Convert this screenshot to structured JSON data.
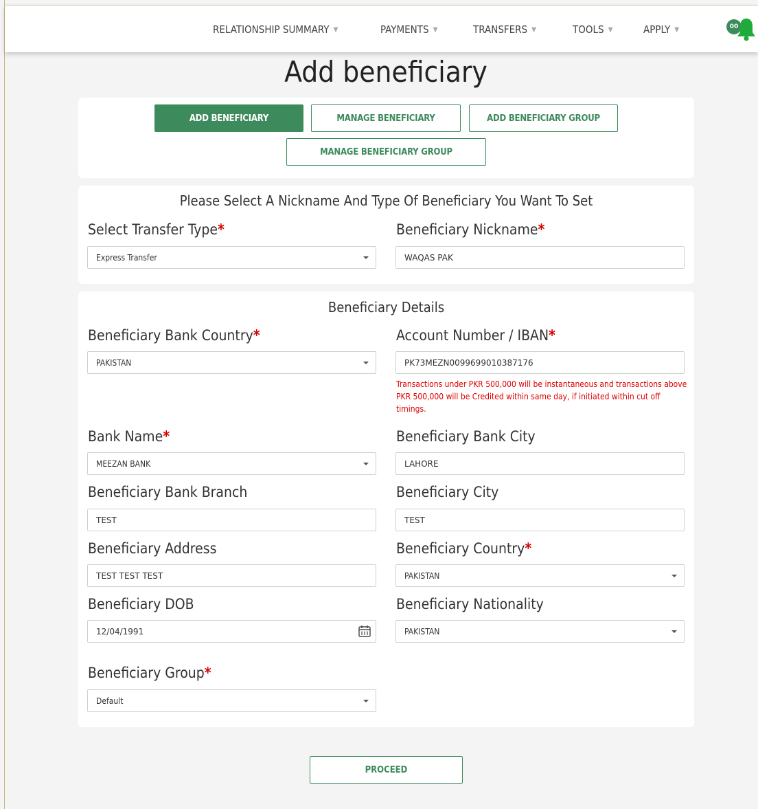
{
  "nav": {
    "items": [
      {
        "label": "RELATIONSHIP SUMMARY"
      },
      {
        "label": "PAYMENTS"
      },
      {
        "label": "TRANSFERS"
      },
      {
        "label": "TOOLS"
      },
      {
        "label": "APPLY"
      }
    ],
    "notification_badge": "00",
    "bell_icon": "bell-icon",
    "caret_icon": "caret-down-icon"
  },
  "page": {
    "title": "Add beneficiary"
  },
  "tabs": [
    {
      "label": "ADD BENEFICIARY",
      "active": true
    },
    {
      "label": "MANAGE BENEFICIARY",
      "active": false
    },
    {
      "label": "ADD BENEFICIARY GROUP",
      "active": false
    },
    {
      "label": "MANAGE BENEFICIARY GROUP",
      "active": false
    }
  ],
  "nickname_section": {
    "title": "Please Select A Nickname And Type Of Beneficiary You Want To Set",
    "transfer_type_label": "Select Transfer Type",
    "transfer_type_value": "Express Transfer",
    "nickname_label": "Beneficiary Nickname",
    "nickname_value": "WAQAS PAK"
  },
  "details_section": {
    "title": "Beneficiary Details",
    "bank_country_label": "Beneficiary Bank Country",
    "bank_country_value": "PAKISTAN",
    "account_label": "Account Number / IBAN",
    "account_value": "PK73MEZN0099699010387176",
    "note": "Transactions under PKR 500,000 will be instantaneous and transactions above PKR 500,000 will be Credited within same day, if initiated within cut off timings.",
    "bank_name_label": "Bank Name",
    "bank_name_value": "MEEZAN BANK",
    "bank_city_label": "Beneficiary Bank City",
    "bank_city_value": "LAHORE",
    "branch_label": "Beneficiary Bank Branch",
    "branch_value": "TEST",
    "city_label": "Beneficiary City",
    "city_value": "TEST",
    "address_label": "Beneficiary Address",
    "address_value": "TEST TEST TEST",
    "country_label": "Beneficiary Country",
    "country_value": "PAKISTAN",
    "dob_label": "Beneficiary DOB",
    "dob_value": "12/04/1991",
    "nationality_label": "Beneficiary Nationality",
    "nationality_value": "PAKISTAN",
    "group_label": "Beneficiary Group",
    "group_value": "Default"
  },
  "actions": {
    "proceed_label": "PROCEED"
  },
  "colors": {
    "brand": "#3d8a5c",
    "required": "#d60000",
    "note": "#e00000"
  }
}
